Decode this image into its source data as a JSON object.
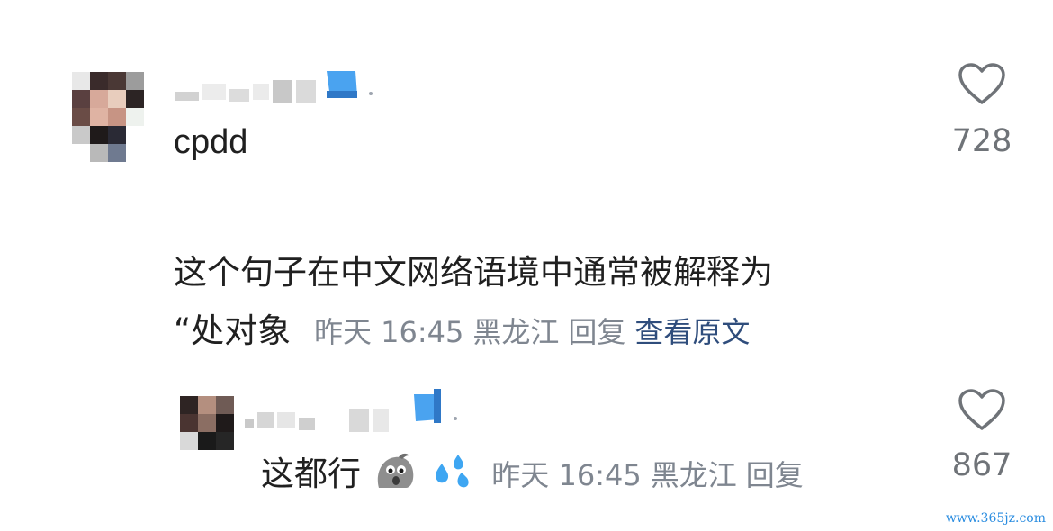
{
  "comments": [
    {
      "username": "",
      "text_line1": "cpdd",
      "text_line2": "",
      "meta": {
        "time": "",
        "location": "",
        "reply": "",
        "view_original": ""
      },
      "likes": "728"
    },
    {
      "username": "",
      "text_line1": "这个句子在中文网络语境中通常被解释为",
      "text_line2": "“处对象",
      "meta": {
        "time": "昨天 16:45",
        "location": "黑龙江",
        "reply": "回复",
        "view_original": "查看原文"
      },
      "likes": ""
    },
    {
      "username": "",
      "text_line1": "这都行",
      "emojis": [
        "ghost-emoji",
        "sweat-droplets-emoji"
      ],
      "meta": {
        "time": "昨天 16:45",
        "location": "黑龙江",
        "reply": "回复"
      },
      "likes": "867"
    }
  ],
  "colors": {
    "meta": "#7f8690",
    "link": "#2f4d7c",
    "badge": "#4aa3f0"
  },
  "icons": {
    "like": "heart-outline-icon",
    "badge": "verified-badge-icon"
  },
  "watermark": "www.365jz.com"
}
